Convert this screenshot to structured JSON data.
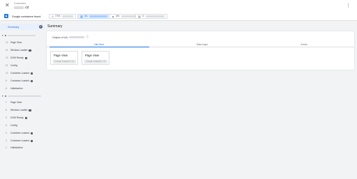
{
  "header": {
    "subtitle": "Connected",
    "title_suffix": ".cz",
    "close_icon": "close-icon",
    "menu_icon": "more-vert-icon"
  },
  "container_bar": {
    "found_label": "Google containers found",
    "chips": [
      {
        "prefix": "GTM-",
        "icon": "tag-manager-icon",
        "active": false
      },
      {
        "prefix": "UA-",
        "icon": "analytics-icon",
        "active": true
      },
      {
        "prefix": "AW-",
        "icon": "ads-icon",
        "active": false
      },
      {
        "prefix": "G-",
        "icon": "ga4-icon",
        "active": false
      }
    ]
  },
  "sidebar": {
    "summary_label": "Summary",
    "summary_badge": "2",
    "groups": [
      {
        "items": [
          {
            "num": "10",
            "label": "Page View",
            "tag": false
          },
          {
            "num": "11",
            "label": "Window Loaded",
            "tag": true
          },
          {
            "num": "12",
            "label": "DOM Ready",
            "tag": true
          },
          {
            "num": "11",
            "label": "Config",
            "tag": false
          },
          {
            "num": "10",
            "label": "Container Loaded",
            "tag": true
          },
          {
            "num": "9",
            "label": "Container Loaded",
            "tag": true
          },
          {
            "num": "8",
            "label": "Initialization",
            "tag": false
          }
        ]
      },
      {
        "items": [
          {
            "num": "7",
            "label": "Page View",
            "tag": false
          },
          {
            "num": "6",
            "label": "Window Loaded",
            "tag": true
          },
          {
            "num": "5",
            "label": "DOM Ready",
            "tag": true
          },
          {
            "num": "4",
            "label": "Config",
            "tag": false
          },
          {
            "num": "3",
            "label": "Container Loaded",
            "tag": true
          },
          {
            "num": "2",
            "label": "Container Loaded",
            "tag": true
          },
          {
            "num": "1",
            "label": "Initialization",
            "tag": false
          }
        ]
      }
    ]
  },
  "main": {
    "title": "Summary",
    "output_label": "Output of UA-",
    "tabs": [
      {
        "label": "Hits Sent",
        "active": true
      },
      {
        "label": "Data Layer",
        "active": false
      },
      {
        "label": "Errors",
        "active": false
      }
    ],
    "hits": [
      {
        "name": "Page View",
        "type": "Google Analytics: Un"
      },
      {
        "name": "Page View",
        "type": "Google Analytics: Un"
      }
    ]
  },
  "colors": {
    "accent": "#1a73e8",
    "active_bg": "#e8f0fe",
    "page_bg": "#f1f3f4"
  }
}
